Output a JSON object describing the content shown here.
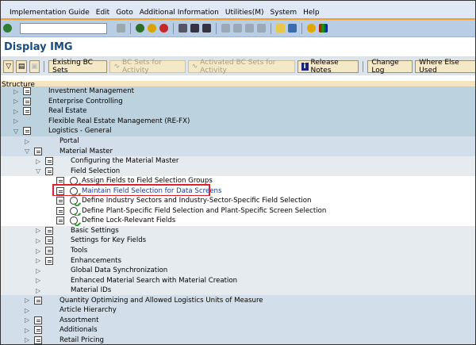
{
  "menu": [
    "Implementation Guide",
    "Edit",
    "Goto",
    "Additional Information",
    "Utilities(M)",
    "System",
    "Help"
  ],
  "toolbar": {
    "command_value": ""
  },
  "title": "Display IMG",
  "app_toolbar": {
    "existing_bc_sets": "Existing BC Sets",
    "bc_sets_activity": "BC Sets for Activity",
    "activated_bc_sets": "Activated BC Sets for Activity",
    "release_notes": "Release Notes",
    "change_log": "Change Log",
    "where_used": "Where Else Used"
  },
  "structure_header": "Structure",
  "tree": [
    {
      "label": "Investment Management",
      "level": 0,
      "state": "collapsed",
      "doc": true
    },
    {
      "label": "Enterprise Controlling",
      "level": 0,
      "state": "collapsed",
      "doc": true
    },
    {
      "label": "Real Estate",
      "level": 0,
      "state": "collapsed",
      "doc": true
    },
    {
      "label": "Flexible Real Estate Management (RE-FX)",
      "level": 0,
      "state": "collapsed",
      "doc": false
    },
    {
      "label": "Logistics - General",
      "level": 0,
      "state": "expanded",
      "doc": true
    },
    {
      "label": "Portal",
      "level": 1,
      "state": "collapsed",
      "doc": false
    },
    {
      "label": "Material Master",
      "level": 1,
      "state": "expanded",
      "doc": true
    },
    {
      "label": "Configuring the Material Master",
      "level": 2,
      "state": "collapsed",
      "doc": true
    },
    {
      "label": "Field Selection",
      "level": 2,
      "state": "expanded",
      "doc": true
    },
    {
      "label": "Assign Fields to Field Selection Groups",
      "level": 3,
      "state": "leaf",
      "doc": true
    },
    {
      "label": "Maintain Field Selection for Data Screens",
      "level": 3,
      "state": "leaf",
      "doc": true,
      "selected": true
    },
    {
      "label": "Define Industry Sectors and Industry-Sector-Specific Field Selection",
      "level": 3,
      "state": "leaf",
      "doc": true
    },
    {
      "label": "Define Plant-Specific Field Selection and Plant-Specific Screen Selection",
      "level": 3,
      "state": "leaf",
      "doc": true
    },
    {
      "label": "Define Lock-Relevant Fields",
      "level": 3,
      "state": "leaf",
      "doc": true
    },
    {
      "label": "Basic Settings",
      "level": 2,
      "state": "collapsed",
      "doc": true
    },
    {
      "label": "Settings for Key Fields",
      "level": 2,
      "state": "collapsed",
      "doc": true
    },
    {
      "label": "Tools",
      "level": 2,
      "state": "collapsed",
      "doc": true
    },
    {
      "label": "Enhancements",
      "level": 2,
      "state": "collapsed",
      "doc": true
    },
    {
      "label": "Global Data Synchronization",
      "level": 2,
      "state": "collapsed",
      "doc": false
    },
    {
      "label": "Enhanced Material Search with Material Creation",
      "level": 2,
      "state": "collapsed",
      "doc": false
    },
    {
      "label": "Material IDs",
      "level": 2,
      "state": "collapsed",
      "doc": false
    },
    {
      "label": "Quantity Optimizing and Allowed Logistics Units of Measure",
      "level": 1,
      "state": "collapsed",
      "doc": true
    },
    {
      "label": "Article Hierarchy",
      "level": 1,
      "state": "collapsed",
      "doc": false
    },
    {
      "label": "Assortment",
      "level": 1,
      "state": "collapsed",
      "doc": true
    },
    {
      "label": "Additionals",
      "level": 1,
      "state": "collapsed",
      "doc": true
    },
    {
      "label": "Retail Pricing",
      "level": 1,
      "state": "collapsed",
      "doc": true
    }
  ]
}
